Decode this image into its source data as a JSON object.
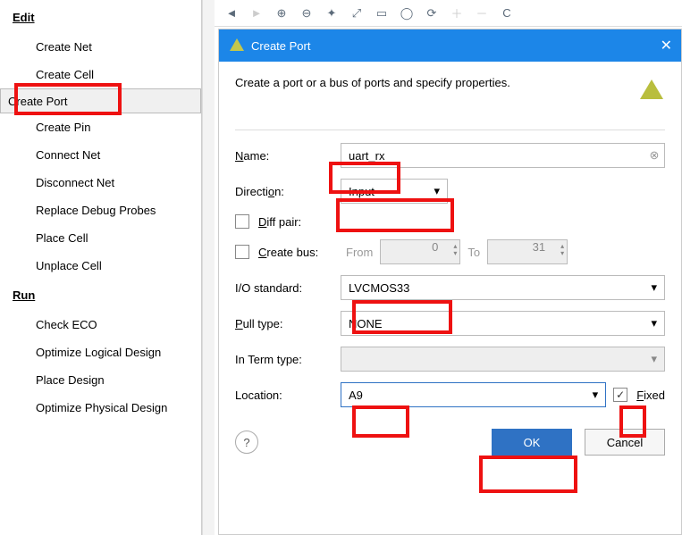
{
  "sidebar": {
    "sections": [
      {
        "title": "Edit",
        "items": [
          {
            "label": "Create Net"
          },
          {
            "label": "Create Cell"
          },
          {
            "label": "Create Port",
            "selected": true
          },
          {
            "label": "Create Pin"
          },
          {
            "label": "Connect Net"
          },
          {
            "label": "Disconnect Net"
          },
          {
            "label": "Replace Debug Probes"
          },
          {
            "label": "Place Cell"
          },
          {
            "label": "Unplace Cell"
          }
        ]
      },
      {
        "title": "Run",
        "items": [
          {
            "label": "Check ECO"
          },
          {
            "label": "Optimize Logical Design"
          },
          {
            "label": "Place Design"
          },
          {
            "label": "Optimize Physical Design"
          }
        ]
      }
    ]
  },
  "dialog": {
    "title": "Create Port",
    "description": "Create a port or a bus of ports and specify properties.",
    "labels": {
      "name": "Name:",
      "direction": "Direction:",
      "diff": "Diff pair:",
      "bus": "Create bus:",
      "from": "From",
      "to": "To",
      "io": "I/O standard:",
      "pull": "Pull type:",
      "interm": "In Term type:",
      "location": "Location:",
      "fixed": "Fixed"
    },
    "values": {
      "name": "uart_rx",
      "direction": "Input",
      "from": "0",
      "to": "31",
      "io": "LVCMOS33",
      "pull": "NONE",
      "interm": "",
      "location": "A9",
      "fixed": true
    },
    "underline": {
      "name": "N",
      "direction": "o",
      "diff": "D",
      "bus": "C",
      "pull": "P",
      "fixed": "F"
    },
    "buttons": {
      "ok": "OK",
      "cancel": "Cancel"
    }
  }
}
